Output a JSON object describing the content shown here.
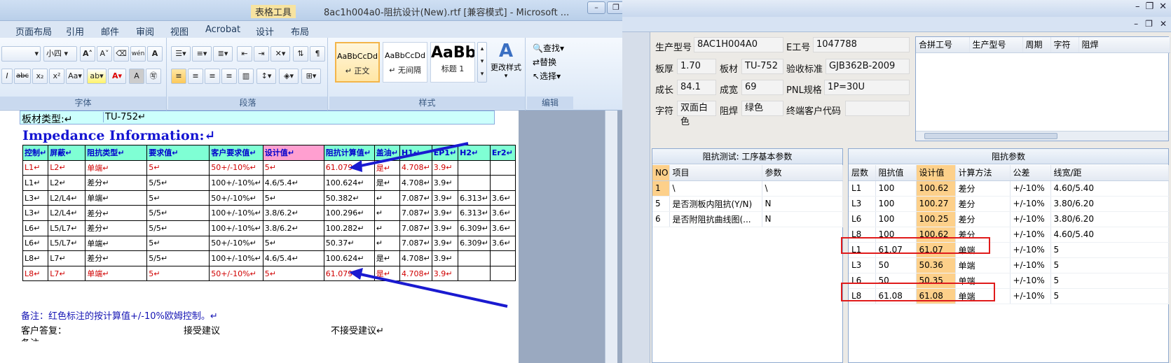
{
  "word": {
    "context_tab": "表格工具",
    "title": "8ac1h004a0-阻抗设计(New).rtf [兼容模式] - Microsoft ...",
    "menu": [
      "页面布局",
      "引用",
      "邮件",
      "审阅",
      "视图",
      "Acrobat",
      "设计",
      "布局"
    ],
    "font_size": "小四",
    "styles": [
      {
        "preview": "AaBbCcDd",
        "name": "↵ 正文"
      },
      {
        "preview": "AaBbCcDd",
        "name": "↵ 无间隔"
      },
      {
        "preview": "AaBb",
        "name": "标题 1"
      }
    ],
    "change_styles": "更改样式",
    "edit": {
      "find": "查找",
      "replace": "替换",
      "select": "选择"
    },
    "groups": {
      "font": "字体",
      "paragraph": "段落",
      "styles": "样式",
      "edit": "编辑"
    },
    "doc": {
      "board_type_label": "板材类型:↵",
      "board_type_value": "TU-752↵",
      "title": "Impedance Information:↵",
      "headers": [
        "控制↵",
        "屏蔽↵",
        "阻抗类型↵",
        "要求值↵",
        "客户要求值↵",
        "设计值↵",
        "阻抗计算值↵",
        "盖油↵",
        "H1↵",
        "EP1↵",
        "H2↵",
        "Er2↵"
      ],
      "rows": [
        {
          "red": true,
          "cells": [
            "L1↵",
            "L2↵",
            "单端↵",
            "5↵",
            "50+/-10%↵",
            "5↵",
            "61.079↵",
            "是↵",
            "4.708↵",
            "3.9↵",
            "",
            ""
          ]
        },
        {
          "red": false,
          "cells": [
            "L1↵",
            "L2↵",
            "差分↵",
            "5/5↵",
            "100+/-10%↵",
            "4.6/5.4↵",
            "100.624↵",
            "是↵",
            "4.708↵",
            "3.9↵",
            "",
            ""
          ]
        },
        {
          "red": false,
          "cells": [
            "L3↵",
            "L2/L4↵",
            "单端↵",
            "5↵",
            "50+/-10%↵",
            "5↵",
            "50.382↵",
            "↵",
            "7.087↵",
            "3.9↵",
            "6.313↵",
            "3.6↵"
          ]
        },
        {
          "red": false,
          "cells": [
            "L3↵",
            "L2/L4↵",
            "差分↵",
            "5/5↵",
            "100+/-10%↵",
            "3.8/6.2↵",
            "100.296↵",
            "↵",
            "7.087↵",
            "3.9↵",
            "6.313↵",
            "3.6↵"
          ]
        },
        {
          "red": false,
          "cells": [
            "L6↵",
            "L5/L7↵",
            "差分↵",
            "5/5↵",
            "100+/-10%↵",
            "3.8/6.2↵",
            "100.282↵",
            "↵",
            "7.087↵",
            "3.9↵",
            "6.309↵",
            "3.6↵"
          ]
        },
        {
          "red": false,
          "cells": [
            "L6↵",
            "L5/L7↵",
            "单端↵",
            "5↵",
            "50+/-10%↵",
            "5↵",
            "50.37↵",
            "↵",
            "7.087↵",
            "3.9↵",
            "6.309↵",
            "3.6↵"
          ]
        },
        {
          "red": false,
          "cells": [
            "L8↵",
            "L7↵",
            "差分↵",
            "5/5↵",
            "100+/-10%↵",
            "4.6/5.4↵",
            "100.624↵",
            "是↵",
            "4.708↵",
            "3.9↵",
            "",
            ""
          ]
        },
        {
          "red": true,
          "cells": [
            "L8↵",
            "L7↵",
            "单端↵",
            "5↵",
            "50+/-10%↵",
            "5↵",
            "61.079↵",
            "是↵",
            "4.708↵",
            "3.9↵",
            "",
            ""
          ]
        }
      ],
      "note": "备注：红色标注的按计算值+/-10%欧姆控制。↵",
      "reply_label": "客户答复：",
      "accept": "接受建议",
      "reject": "不接受建议↵",
      "remark": "备注"
    }
  },
  "app": {
    "fields": {
      "model_label": "生产型号",
      "model": "8AC1H004A0",
      "job_label": "E工号",
      "job": "1047788",
      "thick_label": "板厚",
      "thick": "1.70",
      "material_label": "板材",
      "material": "TU-752",
      "std_label": "验收标准",
      "std": "GJB362B-2009",
      "len_label": "成长",
      "len": "84.1",
      "wid_label": "成宽",
      "wid": "69",
      "pnl_label": "PNL规格",
      "pnl": "1P=30U",
      "char_label": "字符",
      "char": "双面白色",
      "mask_label": "阻焊",
      "mask": "绿色",
      "cust_label": "终端客户代码",
      "cust": ""
    },
    "merge_headers": [
      "合拼工号",
      "生产型号",
      "周期",
      "字符",
      "阻焊"
    ],
    "test_panel": {
      "title": "阻抗测试: 工序基本参数",
      "headers": [
        "NO",
        "项目",
        "参数"
      ],
      "rows": [
        [
          "1",
          "\\",
          "\\"
        ],
        [
          "5",
          "是否测板内阻抗(Y/N)",
          "N"
        ],
        [
          "6",
          "是否附阻抗曲线图(...",
          "N"
        ]
      ]
    },
    "imp_panel": {
      "title": "阻抗参数",
      "headers": [
        "层数",
        "阻抗值",
        "设计值",
        "计算方法",
        "公差",
        "线宽/距"
      ],
      "rows": [
        [
          "L1",
          "100",
          "100.62",
          "差分",
          "+/-10%",
          "4.60/5.40"
        ],
        [
          "L3",
          "100",
          "100.27",
          "差分",
          "+/-10%",
          "3.80/6.20"
        ],
        [
          "L6",
          "100",
          "100.25",
          "差分",
          "+/-10%",
          "3.80/6.20"
        ],
        [
          "L8",
          "100",
          "100.62",
          "差分",
          "+/-10%",
          "4.60/5.40"
        ],
        [
          "L1",
          "61.07",
          "61.07",
          "单端",
          "+/-10%",
          "5"
        ],
        [
          "L3",
          "50",
          "50.36",
          "单端",
          "+/-10%",
          "5"
        ],
        [
          "L6",
          "50",
          "50.35",
          "单端",
          "+/-10%",
          "5"
        ],
        [
          "L8",
          "61.08",
          "61.08",
          "单端",
          "+/-10%",
          "5"
        ]
      ]
    }
  }
}
